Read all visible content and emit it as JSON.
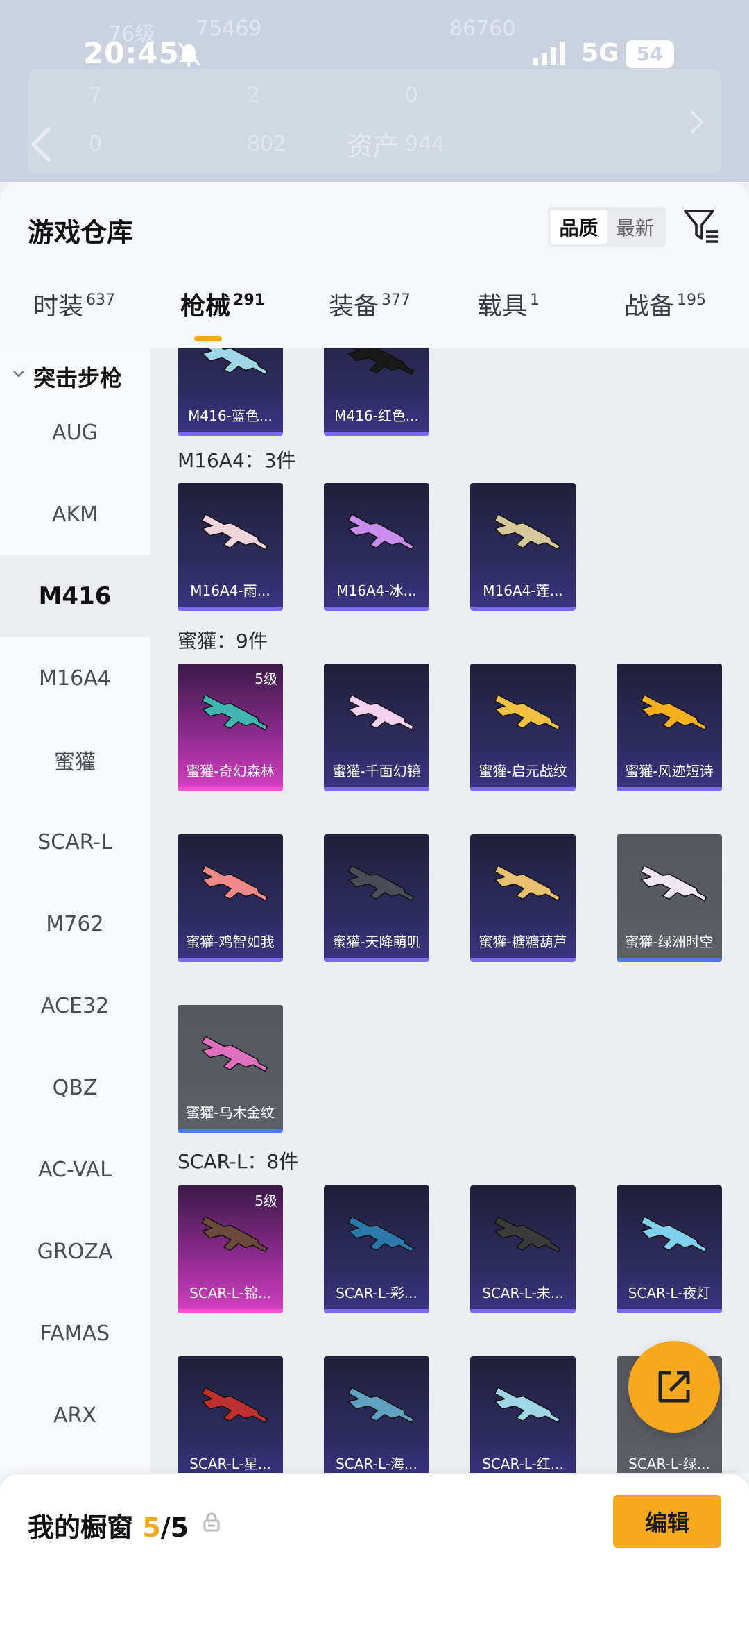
{
  "status_bar": {
    "time": "20:45",
    "network": "5G",
    "battery": "54"
  },
  "background_ghost": {
    "level": "76级",
    "coins": "75469",
    "score": "86760",
    "stat_a": "7",
    "stat_b": "2",
    "stat_c": "0",
    "stat_d": "0",
    "stat_e": "802",
    "assets_label": "资产",
    "assets_value": "944"
  },
  "sheet": {
    "title": "游戏仓库",
    "sort": {
      "quality": "品质",
      "newest": "最新"
    }
  },
  "categories": [
    {
      "label": "时装",
      "count": "637"
    },
    {
      "label": "枪械",
      "count": "291"
    },
    {
      "label": "装备",
      "count": "377"
    },
    {
      "label": "载具",
      "count": "1"
    },
    {
      "label": "战备",
      "count": "195"
    }
  ],
  "sidebar": {
    "group": "突击步枪",
    "items": [
      "AUG",
      "AKM",
      "M416",
      "M16A4",
      "蜜獾",
      "SCAR-L",
      "M762",
      "ACE32",
      "QBZ",
      "AC-VAL",
      "GROZA",
      "FAMAS",
      "ARX"
    ]
  },
  "sections": {
    "m416_cards": [
      "M416-蓝色...",
      "M416-红色..."
    ],
    "m16a4_title": "M16A4：3件",
    "m16a4_cards": [
      "M16A4-雨...",
      "M16A4-冰...",
      "M16A4-莲..."
    ],
    "honeybadger_title": "蜜獾：9件",
    "honeybadger_cards": [
      "蜜獾-奇幻森林",
      "蜜獾-千面幻镜",
      "蜜獾-启元战纹",
      "蜜獾-风迹短诗",
      "蜜獾-鸡智如我",
      "蜜獾-天降萌叽",
      "蜜獾-糖糖葫芦",
      "蜜獾-绿洲时空",
      "蜜獾-乌木金纹"
    ],
    "scarl_title": "SCAR-L：8件",
    "scarl_cards": [
      "SCAR-L-锦...",
      "SCAR-L-彩...",
      "SCAR-L-未...",
      "SCAR-L-夜灯",
      "SCAR-L-星...",
      "SCAR-L-海...",
      "SCAR-L-红...",
      "SCAR-L-绿..."
    ],
    "level_badge": "5级"
  },
  "bottom": {
    "showcase_label": "我的橱窗",
    "showcase_count": "5",
    "showcase_total": "/5",
    "edit_label": "编辑"
  },
  "colors": {
    "accent": "#f7a91d",
    "purple_card": "#2d2b5c",
    "legendary_card": "#d03ebf",
    "gray_card": "#5e6068"
  }
}
